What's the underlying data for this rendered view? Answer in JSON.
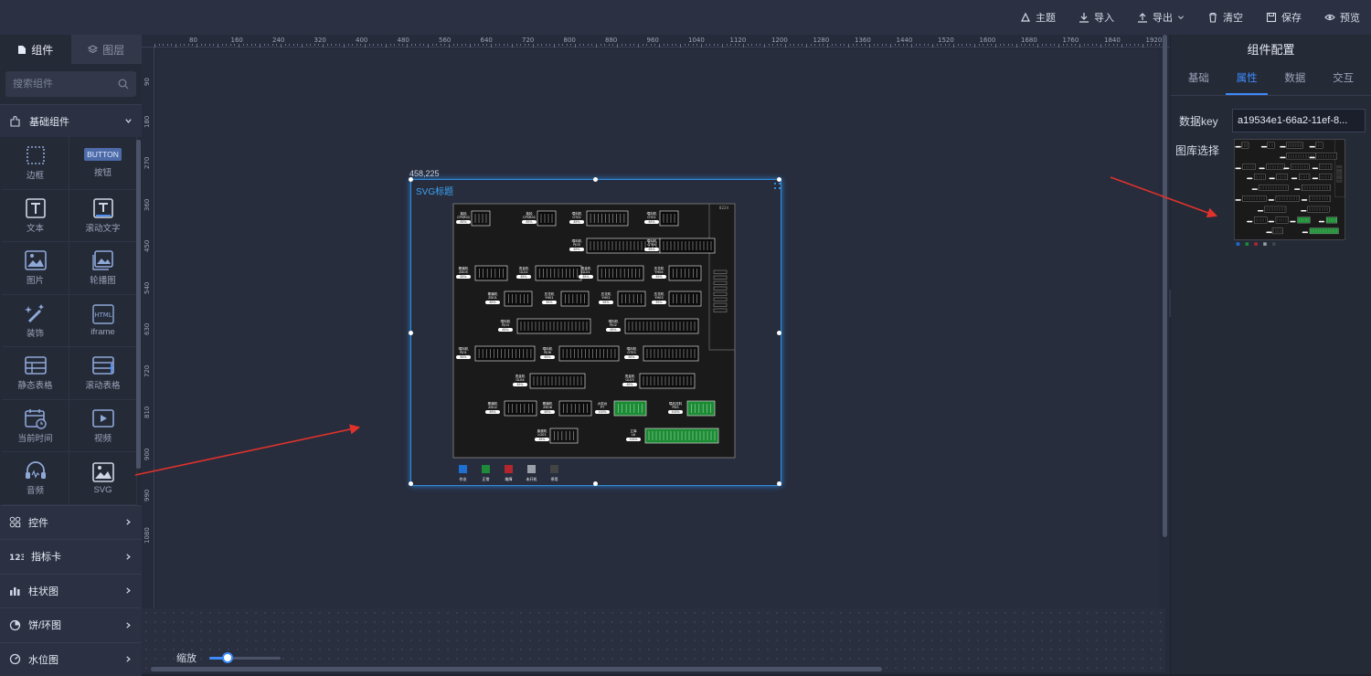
{
  "toolbar": {
    "theme": "主题",
    "import": "导入",
    "export": "导出",
    "clear": "清空",
    "save": "保存",
    "preview": "预览"
  },
  "left_panel": {
    "tabs": [
      "组件",
      "图层"
    ],
    "search_placeholder": "搜索组件",
    "basic_category": "基础组件",
    "components": [
      "边框",
      "按钮",
      "文本",
      "滚动文字",
      "图片",
      "轮播图",
      "装饰",
      "iframe",
      "静态表格",
      "滚动表格",
      "当前时间",
      "视频",
      "音频",
      "SVG"
    ],
    "button_icon_text": "BUTTON",
    "html_icon_text": "HTML",
    "categories": [
      "控件",
      "指标卡",
      "柱状图",
      "饼/环图",
      "水位图"
    ]
  },
  "ruler": {
    "top": [
      "80",
      "160",
      "240",
      "320",
      "400",
      "480",
      "560",
      "640",
      "720",
      "800",
      "880",
      "960",
      "1040",
      "1120",
      "1200",
      "1280",
      "1360",
      "1440",
      "1520",
      "1600",
      "1680",
      "1760",
      "1840",
      "1920"
    ],
    "left": [
      "90",
      "180",
      "270",
      "360",
      "450",
      "540",
      "630",
      "720",
      "810",
      "900",
      "990",
      "1080"
    ]
  },
  "canvas": {
    "coords": "458,225",
    "svg_title": "SVG标题",
    "zoom_label": "缩放",
    "zoom_level": 0.25
  },
  "diagram": {
    "legend": [
      "作业",
      "正常",
      "故障",
      "未开机",
      "停用"
    ],
    "legend_colors": [
      "#1e6fd0",
      "#1e8a3a",
      "#b3262d",
      "#9aa0aa",
      "#444444"
    ],
    "corner_label": "8224",
    "machines": [
      {
        "name": "抽检",
        "code": "CPSR02",
        "pct": "85%"
      },
      {
        "name": "抽检",
        "code": "CPSR01",
        "pct": "85%"
      },
      {
        "name": "喂料机",
        "code": "GT02",
        "pct": "85%"
      },
      {
        "name": "喂料机",
        "code": "GT01",
        "pct": "85%"
      },
      {
        "name": "喂料机",
        "code": "PJ05",
        "pct": "85%"
      },
      {
        "name": "喂料机",
        "code": "GT04",
        "pct": "85%"
      },
      {
        "name": "覆膜机",
        "code": "ZD05",
        "pct": "85%"
      },
      {
        "name": "烫金机",
        "code": "GL02",
        "pct": "85%"
      },
      {
        "name": "烫金机",
        "code": "GL01",
        "pct": "85%"
      },
      {
        "name": "压花机",
        "code": "YH04",
        "pct": "85%"
      },
      {
        "name": "覆膜机",
        "code": "ZD01",
        "pct": "85%"
      },
      {
        "name": "压花机",
        "code": "YH01",
        "pct": "85%"
      },
      {
        "name": "压花机",
        "code": "YH02",
        "pct": "85%"
      },
      {
        "name": "压花机",
        "code": "YH03",
        "pct": "85%"
      },
      {
        "name": "喂料机",
        "code": "PJ03",
        "pct": "85%"
      },
      {
        "name": "喂料机",
        "code": "PJ02",
        "pct": "85%"
      },
      {
        "name": "喂料机",
        "code": "PJ01",
        "pct": "85%"
      },
      {
        "name": "喂料机",
        "code": "PJ06",
        "pct": "85%"
      },
      {
        "name": "喂料机",
        "code": "GT03",
        "pct": "85%"
      },
      {
        "name": "烫金机",
        "code": "GL04",
        "pct": "85%"
      },
      {
        "name": "烫金机",
        "code": "GL03",
        "pct": "85%"
      },
      {
        "name": "覆膜机",
        "code": "ZD02",
        "pct": "85%"
      },
      {
        "name": "覆膜机",
        "code": "ZD06",
        "pct": "85%"
      },
      {
        "name": "大胶台",
        "code": "PT",
        "pct": "100%"
      },
      {
        "name": "喂品送料",
        "code": "PDS",
        "pct": "100%"
      },
      {
        "name": "废墨机",
        "code": "LG01",
        "pct": "85%"
      },
      {
        "name": "立库",
        "code": "LK",
        "pct": "100%"
      }
    ]
  },
  "right_panel": {
    "title": "组件配置",
    "tabs": [
      "基础",
      "属性",
      "数据",
      "交互"
    ],
    "data_key_label": "数据key",
    "data_key_value": "a19534e1-66a2-11ef-8...",
    "library_label": "图库选择"
  },
  "colors": {
    "accent": "#3d8bfd",
    "selection": "#2f8cd8",
    "annotation_arrow": "#e0322b"
  }
}
